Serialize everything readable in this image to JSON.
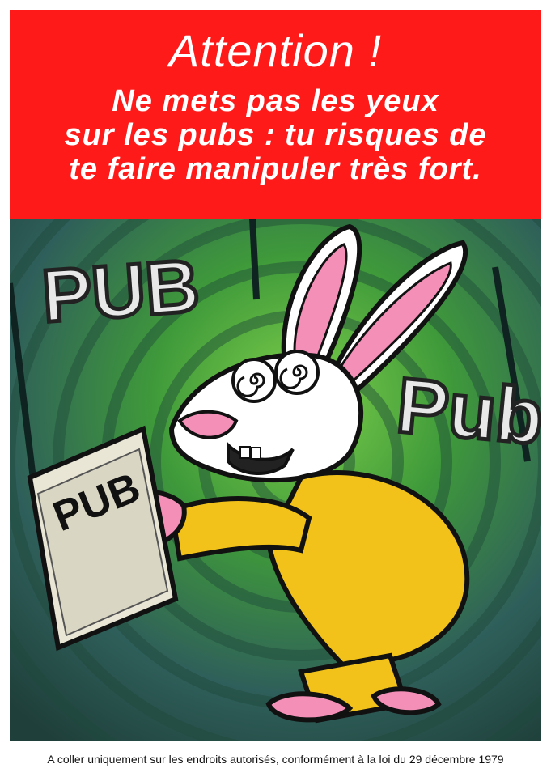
{
  "banner": {
    "title": "Attention !",
    "lines": [
      "Ne mets pas les yeux",
      "sur les pubs : tu risques de",
      "te faire manipuler très fort."
    ],
    "background_color": "#ff1a1a"
  },
  "illustration": {
    "sign_left": "PUB",
    "sign_right": "Pub",
    "magazine_cover": "PUB",
    "background_colors": [
      "#3f9a3a",
      "#2f5f5a",
      "#1f3f3a"
    ],
    "rabbit_colors": {
      "fur": "#ffffff",
      "ears": "#f48fb8",
      "outfit": "#f2c21b"
    }
  },
  "footer": {
    "text": "A coller uniquement sur les endroits autorisés, conformément à la loi du 29 décembre 1979"
  }
}
